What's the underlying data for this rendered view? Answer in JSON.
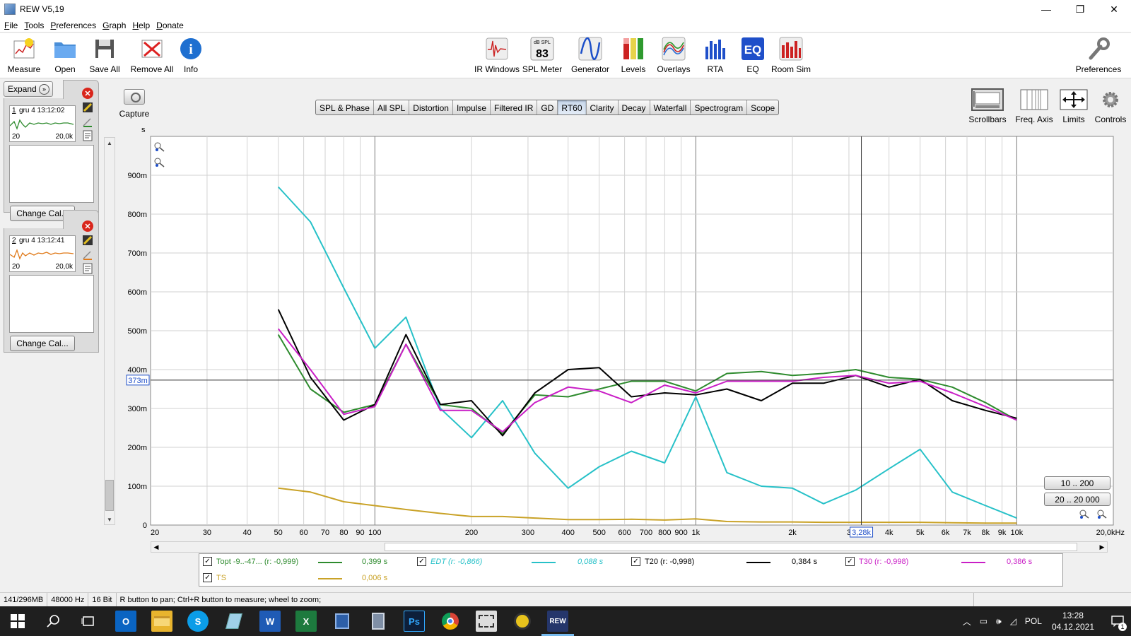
{
  "window": {
    "title": "REW V5,19",
    "minimize": "—",
    "maximize": "❐",
    "close": "✕"
  },
  "menu": [
    "File",
    "Tools",
    "Preferences",
    "Graph",
    "Help",
    "Donate"
  ],
  "toolbar": {
    "left": [
      {
        "label": "Measure",
        "icon": "measure-icon"
      },
      {
        "label": "Open",
        "icon": "folder-icon"
      },
      {
        "label": "Save All",
        "icon": "save-icon"
      },
      {
        "label": "Remove All",
        "icon": "remove-all-icon"
      },
      {
        "label": "Info",
        "icon": "info-icon"
      }
    ],
    "center": [
      {
        "label": "IR Windows",
        "icon": "ir-windows-icon"
      },
      {
        "label": "SPL Meter",
        "icon": "spl-meter-icon",
        "display_unit": "dB SPL",
        "display_value": "83"
      },
      {
        "label": "Generator",
        "icon": "generator-icon"
      },
      {
        "label": "Levels",
        "icon": "levels-icon"
      },
      {
        "label": "Overlays",
        "icon": "overlays-icon"
      },
      {
        "label": "RTA",
        "icon": "rta-icon"
      },
      {
        "label": "EQ",
        "icon": "eq-icon"
      },
      {
        "label": "Room Sim",
        "icon": "room-sim-icon"
      }
    ],
    "preferences": "Preferences"
  },
  "left_panel": {
    "expand": "Expand",
    "measurements": [
      {
        "num": "1",
        "name": "gru 4 13:12:02",
        "lo": "20",
        "hi": "20,0k",
        "color": "#2e8b2e",
        "change_cal": "Change Cal..."
      },
      {
        "num": "2",
        "name": "gru 4 13:12:41",
        "lo": "20",
        "hi": "20,0k",
        "color": "#e07a1a",
        "change_cal": "Change Cal..."
      }
    ]
  },
  "capture": "Capture",
  "graph_tabs": [
    "SPL & Phase",
    "All SPL",
    "Distortion",
    "Impulse",
    "Filtered IR",
    "GD",
    "RT60",
    "Clarity",
    "Decay",
    "Waterfall",
    "Spectrogram",
    "Scope"
  ],
  "active_tab": "RT60",
  "right_tools": [
    "Scrollbars",
    "Freq. Axis",
    "Limits",
    "Controls"
  ],
  "range_buttons": [
    "10 .. 200",
    "20 .. 20 000"
  ],
  "legend": [
    {
      "name": "Topt -9..-47... (r: -0,999)",
      "value": "0,399 s",
      "color": "#2e8b2e",
      "italic": false,
      "checked": true
    },
    {
      "name": "EDT (r: -0,866)",
      "value": "0,088 s",
      "color": "#27c1c8",
      "italic": true,
      "checked": true
    },
    {
      "name": "T20 (r: -0,998)",
      "value": "0,384 s",
      "color": "#000000",
      "italic": false,
      "checked": true
    },
    {
      "name": "T30 (r: -0,998)",
      "value": "0,386 s",
      "color": "#c91ec6",
      "italic": false,
      "checked": true
    },
    {
      "name": "TS",
      "value": "0,006 s",
      "color": "#c9a227",
      "italic": false,
      "checked": true
    }
  ],
  "status": {
    "memory": "141/296MB",
    "rate": "48000 Hz",
    "bits": "16 Bit",
    "hint": "R button to pan; Ctrl+R button to measure; wheel to zoom;"
  },
  "taskbar": {
    "lang": "POL",
    "time": "13:28",
    "date": "04.12.2021",
    "notif": "1",
    "apps": [
      "windows-icon",
      "search-icon",
      "task-view-icon",
      "outlook-icon",
      "file-explorer-icon",
      "skype-icon",
      "app-icon",
      "word-icon",
      "excel-icon",
      "save-icon",
      "calculator-icon",
      "photoshop-icon",
      "chrome-icon",
      "media-icon",
      "app-icon",
      "rew-icon"
    ]
  },
  "chart_data": {
    "type": "line",
    "y_unit_label": "s",
    "x_scale": "log",
    "xlim": [
      20,
      20000
    ],
    "ylim": [
      0,
      1.0
    ],
    "x_ticks": [
      {
        "v": 20,
        "l": "20"
      },
      {
        "v": 30,
        "l": "30"
      },
      {
        "v": 40,
        "l": "40"
      },
      {
        "v": 50,
        "l": "50"
      },
      {
        "v": 60,
        "l": "60"
      },
      {
        "v": 70,
        "l": "70"
      },
      {
        "v": 80,
        "l": "80"
      },
      {
        "v": 90,
        "l": "90"
      },
      {
        "v": 100,
        "l": "100"
      },
      {
        "v": 200,
        "l": "200"
      },
      {
        "v": 300,
        "l": "300"
      },
      {
        "v": 400,
        "l": "400"
      },
      {
        "v": 500,
        "l": "500"
      },
      {
        "v": 600,
        "l": "600"
      },
      {
        "v": 700,
        "l": "700"
      },
      {
        "v": 800,
        "l": "800"
      },
      {
        "v": 900,
        "l": "900"
      },
      {
        "v": 1000,
        "l": "1k"
      },
      {
        "v": 2000,
        "l": "2k"
      },
      {
        "v": 3000,
        "l": "3"
      },
      {
        "v": 4000,
        "l": "4k"
      },
      {
        "v": 5000,
        "l": "5k"
      },
      {
        "v": 6000,
        "l": "6k"
      },
      {
        "v": 7000,
        "l": "7k"
      },
      {
        "v": 8000,
        "l": "8k"
      },
      {
        "v": 9000,
        "l": "9k"
      },
      {
        "v": 10000,
        "l": "10k"
      },
      {
        "v": 20000,
        "l": "20,0kHz"
      }
    ],
    "y_ticks": [
      {
        "v": 0,
        "l": "0"
      },
      {
        "v": 0.1,
        "l": "100m"
      },
      {
        "v": 0.2,
        "l": "200m"
      },
      {
        "v": 0.3,
        "l": "300m"
      },
      {
        "v": 0.4,
        "l": "400m"
      },
      {
        "v": 0.5,
        "l": "500m"
      },
      {
        "v": 0.6,
        "l": "600m"
      },
      {
        "v": 0.7,
        "l": "700m"
      },
      {
        "v": 0.8,
        "l": "800m"
      },
      {
        "v": 0.9,
        "l": "900m"
      }
    ],
    "x": [
      50,
      63,
      80,
      100,
      125,
      160,
      200,
      250,
      315,
      400,
      500,
      630,
      800,
      1000,
      1250,
      1600,
      2000,
      2500,
      3150,
      4000,
      5000,
      6300,
      8000,
      10000
    ],
    "series": [
      {
        "name": "Topt -9..-47... (r: -0,999)",
        "color": "#2e8b2e",
        "values": [
          0.49,
          0.35,
          0.29,
          0.31,
          0.465,
          0.31,
          0.3,
          0.235,
          0.335,
          0.33,
          0.35,
          0.37,
          0.37,
          0.345,
          0.39,
          0.395,
          0.385,
          0.39,
          0.4,
          0.38,
          0.375,
          0.355,
          0.315,
          0.27
        ]
      },
      {
        "name": "EDT (r: -0,866)",
        "color": "#27c1c8",
        "values": [
          0.87,
          0.78,
          0.61,
          0.455,
          0.535,
          0.3,
          0.225,
          0.32,
          0.185,
          0.095,
          0.15,
          0.19,
          0.16,
          0.33,
          0.135,
          0.1,
          0.095,
          0.055,
          0.09,
          0.145,
          0.195,
          0.085,
          0.05,
          0.018
        ]
      },
      {
        "name": "T20 (r: -0,998)",
        "color": "#000000",
        "values": [
          0.555,
          0.38,
          0.27,
          0.31,
          0.49,
          0.31,
          0.32,
          0.23,
          0.34,
          0.4,
          0.405,
          0.33,
          0.34,
          0.335,
          0.35,
          0.32,
          0.365,
          0.365,
          0.385,
          0.355,
          0.375,
          0.32,
          0.295,
          0.275
        ]
      },
      {
        "name": "T30 (r: -0,998)",
        "color": "#c91ec6",
        "values": [
          0.505,
          0.4,
          0.285,
          0.305,
          0.465,
          0.295,
          0.295,
          0.24,
          0.315,
          0.355,
          0.345,
          0.315,
          0.36,
          0.34,
          0.37,
          0.37,
          0.37,
          0.38,
          0.385,
          0.365,
          0.37,
          0.34,
          0.305,
          0.27
        ]
      },
      {
        "name": "TS",
        "color": "#c9a227",
        "values": [
          0.095,
          0.085,
          0.06,
          0.05,
          0.04,
          0.03,
          0.022,
          0.022,
          0.018,
          0.014,
          0.014,
          0.015,
          0.013,
          0.016,
          0.009,
          0.008,
          0.008,
          0.007,
          0.007,
          0.007,
          0.007,
          0.006,
          0.005,
          0.005
        ]
      }
    ],
    "cursor": {
      "x_label": "3,28k",
      "x_value": 3280,
      "y_label": "373m",
      "y_value": 0.373
    }
  }
}
